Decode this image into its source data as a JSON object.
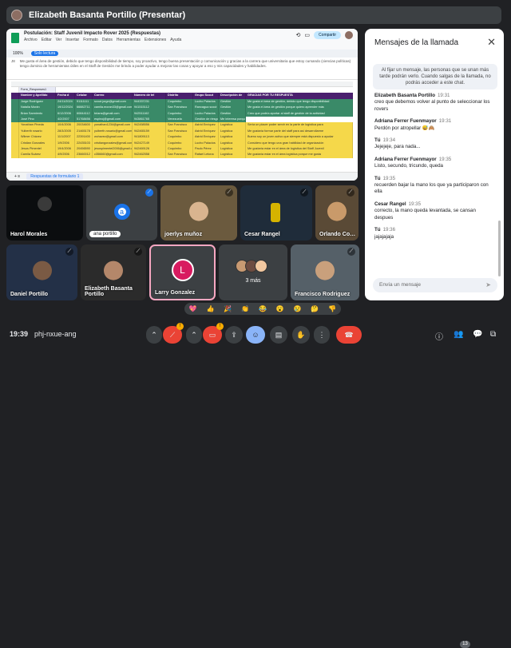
{
  "presenter_bar": {
    "title": "Elizabeth Basanta Portillo (Presentar)"
  },
  "shared_screen": {
    "doc_title": "Postulación: Staff Juvenil Impacto Rover 2025 (Respuestas)",
    "menu": [
      "Archivo",
      "Editar",
      "Ver",
      "Insertar",
      "Formato",
      "Datos",
      "Herramientas",
      "Extensiones",
      "Ayuda"
    ],
    "share_label": "Compartir",
    "zoom": "100%",
    "readonly_label": "Solo lectura",
    "cell_ref": "J8",
    "formula_text": "Me gusta el área de gestión, debido que tengo disponibilidad de tiempo, soy proactivo, tengo buena presentación y comunicación y gracias a la carrera que universitaria que estoy cursando (ciencias políticas) tengo dominio de herramientas útiles en el Staff de Gestión me brindo a poder ayudar a mejorar las cosas y apoyar a eso y mis capacidades y habilidades.",
    "form_label": "Form_Responses1",
    "headers": [
      "Nombre y Apellido",
      "Fecha d",
      "Celular",
      "Correo",
      "Número de tel",
      "Distrito",
      "Grupo Scout",
      "Descripción de",
      "GRACIAS POR TU RESPUESTA"
    ],
    "rows": [
      [
        "Jorge Rodríguez",
        "24/11/2024",
        "91111111",
        "scout.jorge@gmail.com",
        "944337231",
        "Coquimbo",
        "Lucho Palacios",
        "Gestión",
        "Me gusta el área de gestión, debido que tengo disponibilidad"
      ],
      [
        "Natalia Morán",
        "19/12/2024",
        "66882711",
        "camila.moran33@gmail.com",
        "941515112",
        "San Francisco",
        "Rancagua scout",
        "Gestión",
        "Me gusta el área de gestión porque quiero aprender más"
      ],
      [
        "Brian Sarmiento",
        "6/12/2006",
        "60844112",
        "brians@gmail.com",
        "942511162",
        "Coquimbo",
        "Lucho Palacios",
        "Gestión",
        "Creo que podría aportar al staff de gestión de la actividad"
      ],
      [
        "José Pino",
        "4/2/2007",
        "51768456",
        "espinoj@gmail.com",
        "943861765",
        "Venezuela",
        "Gestión de riesgo",
        "Me interesa porque tengo experiencia en actividades"
      ],
      [
        "Yonathan Pineda",
        "10/4/2006",
        "20034600",
        "yonathan1234@gmail.com",
        "942458556",
        "San Francisco",
        "Astrid Enriquez",
        "Logística",
        "Sería un placer poder servir en la parte de logística para"
      ],
      [
        "Yulberth rosario",
        "28/3/2005",
        "21465178",
        "yulberth.rosario@gmail.com",
        "942465159",
        "San Francisco",
        "Astrid Enriquez",
        "Logística",
        "Me gustaría formar parte del staff para así desarrollarme"
      ],
      [
        "Wilmer Chávez",
        "11/1/2007",
        "22391400",
        "wchavez@gmail.com",
        "941809113",
        "Coquimbo",
        "Astrid Enriquez",
        "Logística",
        "Bueno soy un joven activo que siempre está dispuesto a ayudar"
      ],
      [
        "Cristian Gonzales",
        "1/9/2006",
        "22435103",
        "cristiangonzales@gmail.com",
        "942427149",
        "Coquimbo",
        "Lucho Palacios",
        "Logística",
        "Considero que tengo una gran habilidad de organización"
      ],
      [
        "Jesus Pimentel",
        "19/4/2006",
        "20456590",
        "jesuspimentel2006@gmail.com",
        "942469126",
        "Coquimbo",
        "Paulo Pérez",
        "Logística",
        "Me gustaría estar en el área de logística del Staff Juvenil"
      ],
      [
        "Camila Suárez",
        "4/9/2006",
        "23660012",
        "c356660@gmail.com",
        "942462558",
        "San Francisco",
        "Rafael Letona",
        "Logística",
        "Me gustaría estar en el área logística porque me gusta"
      ]
    ],
    "tab_label": "Respuestas de formulario 1"
  },
  "tiles": [
    {
      "name": "Harol Morales",
      "mic": "🎙"
    },
    {
      "name": "ana portillo",
      "initial": "a",
      "mic": "⟋"
    },
    {
      "name": "joerlys muñoz",
      "mic": "⟋"
    },
    {
      "name": "Cesar Rangel",
      "mic": "⟋"
    },
    {
      "name": "Orlando Co…",
      "mic": "⟋"
    },
    {
      "name": "Daniel Portillo",
      "mic": "⟋"
    },
    {
      "name": "Elizabeth Basanta Portillo",
      "mic": "⟋"
    },
    {
      "name": "Larry Gonzalez",
      "initial": "L",
      "mic": "⟋"
    },
    {
      "name": "3 más"
    },
    {
      "name": "Francisco Rodriguez",
      "mic": "⟋"
    }
  ],
  "chat": {
    "title": "Mensajes de la llamada",
    "info": "Al fijar un mensaje, las personas que se unan más tarde podrán verlo. Cuando salgas de la llamada, no podrás acceder a este chat.",
    "messages": [
      {
        "who": "Elizabeth Basanta Portillo",
        "time": "19:31",
        "text": "creo que debemos volver al punto de seleccionar los rovers"
      },
      {
        "who": "Adriana Ferrer Fuenmayor",
        "time": "19:31",
        "text": "Perdón por atropellar 😅🙈"
      },
      {
        "who": "Tú",
        "time": "19:34",
        "text": "Jejejeje, para nada..."
      },
      {
        "who": "Adriana Ferrer Fuenmayor",
        "time": "19:35",
        "text": "Listo, secundo, tricundo, queda"
      },
      {
        "who": "Tú",
        "time": "19:35",
        "text": "recuerden bajar la mano los que ya participaron con ella"
      },
      {
        "who": "Cesar Rangel",
        "time": "19:35",
        "text": "correcto, la mano queda levantada, se cansan despues"
      },
      {
        "who": "Tú",
        "time": "19:36",
        "text": "jajajajaja"
      }
    ],
    "placeholder": "Envía un mensaje"
  },
  "reactions": [
    "💖",
    "👍",
    "🎉",
    "👏",
    "😂",
    "😮",
    "😢",
    "🤔",
    "👎"
  ],
  "bottom": {
    "time": "19:39",
    "code": "phj-nxue-ang",
    "participants": "13"
  }
}
